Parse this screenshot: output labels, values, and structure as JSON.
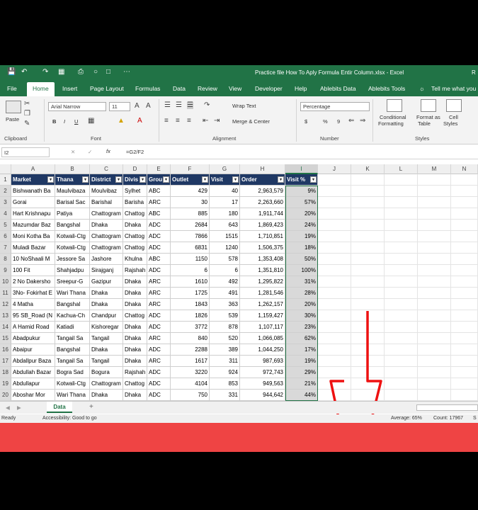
{
  "app": {
    "title": "Practice file How To Aply Formula Entir Column.xlsx  -  Excel",
    "user_initial": "R",
    "accent": "#217346"
  },
  "tabs": [
    "File",
    "Home",
    "Insert",
    "Page Layout",
    "Formulas",
    "Data",
    "Review",
    "View",
    "Developer",
    "Help",
    "Ablebits Data",
    "Ablebits Tools"
  ],
  "active_tab": "Home",
  "tell_me": "Tell me what you",
  "ribbon": {
    "clipboard": {
      "paste": "Paste",
      "label": "Clipboard"
    },
    "font": {
      "name": "Arial Narrow",
      "size": "11",
      "bold": "B",
      "italic": "I",
      "underline": "U",
      "label": "Font"
    },
    "alignment": {
      "wrap_text": "Wrap Text",
      "merge_center": "Merge & Center",
      "label": "Alignment"
    },
    "number": {
      "format": "Percentage",
      "currency": "$",
      "percent": "%",
      "comma": "9",
      "label": "Number"
    },
    "styles": {
      "conditional_1": "Conditional",
      "conditional_2": "Formatting",
      "format_table_1": "Format as",
      "format_table_2": "Table",
      "cell_styles_1": "Cell",
      "cell_styles_2": "Styles",
      "label": "Styles"
    }
  },
  "formula_bar": {
    "name_box": "I2",
    "fx": "fx",
    "formula": "=G2/F2"
  },
  "columns": [
    "A",
    "B",
    "C",
    "D",
    "E",
    "F",
    "G",
    "H",
    "I",
    "J",
    "K",
    "L",
    "M",
    "N"
  ],
  "headers": [
    "Market",
    "Thana",
    "District",
    "Divis",
    "Grou",
    "Outlet",
    "Visit",
    "Order",
    "Visit %"
  ],
  "rows": [
    [
      "Bishwanath Ba",
      "Maulvibaza",
      "Moulvibaz",
      "Sylhet",
      "ABC",
      "429",
      "40",
      "2,963,579",
      "9%"
    ],
    [
      "Gorai",
      "Barisal Sac",
      "Barishal",
      "Barisha",
      "ARC",
      "30",
      "17",
      "2,263,660",
      "57%"
    ],
    [
      "Hart Krishnapu",
      "Patiya",
      "Chattogram",
      "Chattog",
      "ABC",
      "885",
      "180",
      "1,911,744",
      "20%"
    ],
    [
      "Mazumdar Baz",
      "Bangshal",
      "Dhaka",
      "Dhaka",
      "ADC",
      "2684",
      "643",
      "1,869,423",
      "24%"
    ],
    [
      "Moni Kotha Ba",
      "Kotwali-Ctg",
      "Chattogram",
      "Chattog",
      "ADC",
      "7866",
      "1515",
      "1,710,851",
      "19%"
    ],
    [
      "Muladi Bazar",
      "Kotwali-Ctg",
      "Chattogram",
      "Chattog",
      "ADC",
      "6831",
      "1240",
      "1,506,375",
      "18%"
    ],
    [
      "10 NoShaali M",
      "Jessore Sa",
      "Jashore",
      "Khulna",
      "ABC",
      "1150",
      "578",
      "1,353,408",
      "50%"
    ],
    [
      "100 Fit",
      "Shahjadpu",
      "Sirajganj",
      "Rajshah",
      "ADC",
      "6",
      "6",
      "1,351,810",
      "100%"
    ],
    [
      "2 No Dakersho",
      "Sreepur-G",
      "Gazipur",
      "Dhaka",
      "ARC",
      "1610",
      "492",
      "1,295,822",
      "31%"
    ],
    [
      "3No- Fokirhat E",
      "Wari Thana",
      "Dhaka",
      "Dhaka",
      "ARC",
      "1725",
      "491",
      "1,281,546",
      "28%"
    ],
    [
      "4 Matha",
      "Bangshal",
      "Dhaka",
      "Dhaka",
      "ARC",
      "1843",
      "363",
      "1,262,157",
      "20%"
    ],
    [
      "95 SB_Road (N",
      "Kachua-Ch",
      "Chandpur",
      "Chattog",
      "ADC",
      "1826",
      "539",
      "1,159,427",
      "30%"
    ],
    [
      "A Hamid Road",
      "Katiadi",
      "Kishoregar",
      "Dhaka",
      "ADC",
      "3772",
      "878",
      "1,107,117",
      "23%"
    ],
    [
      "Abadpukur",
      "Tangail Sa",
      "Tangail",
      "Dhaka",
      "ARC",
      "840",
      "520",
      "1,066,085",
      "62%"
    ],
    [
      "Abaipur",
      "Bangshal",
      "Dhaka",
      "Dhaka",
      "ADC",
      "2288",
      "389",
      "1,044,250",
      "17%"
    ],
    [
      "Abdallpur Baza",
      "Tangail Sa",
      "Tangail",
      "Dhaka",
      "ARC",
      "1617",
      "311",
      "987,693",
      "19%"
    ],
    [
      "Abdullah Bazar",
      "Bogra Sad",
      "Bogura",
      "Rajshah",
      "ADC",
      "3220",
      "924",
      "972,743",
      "29%"
    ],
    [
      "Abdullapur",
      "Kotwali-Ctg",
      "Chattogram",
      "Chattog",
      "ADC",
      "4104",
      "853",
      "949,563",
      "21%"
    ],
    [
      "Aboshar Mor",
      "Wari Thana",
      "Dhaka",
      "Dhaka",
      "ADC",
      "750",
      "331",
      "944,642",
      "44%"
    ]
  ],
  "sheet": {
    "name": "Data",
    "add": "+"
  },
  "status": {
    "ready": "Ready",
    "accessibility": "Accessibility: Good to go",
    "average": "Average: 65%",
    "count": "Count: 17967",
    "sum": "S"
  }
}
